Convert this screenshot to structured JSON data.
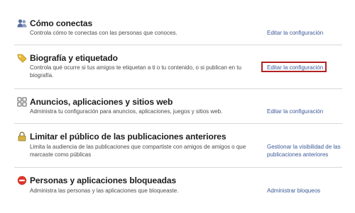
{
  "sections": [
    {
      "title": "Cómo conectas",
      "description": "Controla cómo te conectas con las personas que conoces.",
      "action": "Editar la configuración",
      "icon": "people-icon"
    },
    {
      "title": "Biografía y etiquetado",
      "description": "Controla qué ocurre si tus amigos te etiquetan a ti o tu contenido, o si publican en tu biografía.",
      "action": "Editar la configuración",
      "icon": "tag-icon"
    },
    {
      "title": "Anuncios, aplicaciones y sitios web",
      "description": "Administra tu configuración para anuncios, aplicaciones, juegos y sitios web.",
      "action": "Editar la configuración",
      "icon": "apps-icon"
    },
    {
      "title": "Limitar el público de las publicaciones anteriores",
      "description": "Limita la audiencia de las publicaciones que compartiste con amigos de amigos o que marcaste como públicas",
      "action": "Gestionar la visibilidad de las publicaciones anteriores",
      "icon": "lock-icon"
    },
    {
      "title": "Personas y aplicaciones bloqueadas",
      "description": "Administra las personas y las aplicaciones que bloqueaste.",
      "action": "Administrar bloqueos",
      "icon": "block-icon"
    }
  ],
  "colors": {
    "link": "#3b5998",
    "highlight": "#b22222",
    "separator": "#d9d9d9"
  }
}
